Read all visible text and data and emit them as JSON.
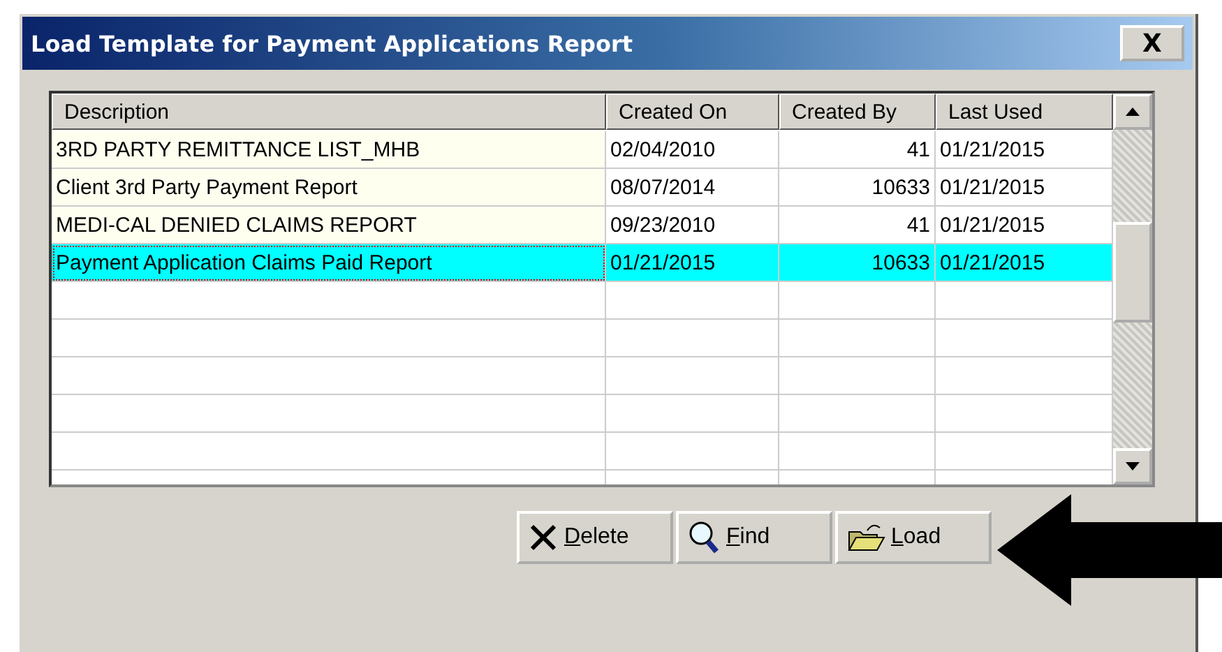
{
  "window": {
    "title": "Load Template for Payment Applications Report",
    "close_label": "X"
  },
  "table": {
    "columns": [
      "Description",
      "Created On",
      "Created By",
      "Last Used"
    ],
    "rows": [
      {
        "cells": [
          "3RD PARTY REMITTANCE LIST_MHB",
          "02/04/2010",
          "41",
          "01/21/2015"
        ],
        "selected": false
      },
      {
        "cells": [
          "Client 3rd Party Payment Report",
          "08/07/2014",
          "10633",
          "01/21/2015"
        ],
        "selected": false
      },
      {
        "cells": [
          "MEDI-CAL DENIED CLAIMS REPORT",
          "09/23/2010",
          "41",
          "01/21/2015"
        ],
        "selected": false
      },
      {
        "cells": [
          "Payment Application Claims Paid Report",
          "01/21/2015",
          "10633",
          "01/21/2015"
        ],
        "selected": true
      }
    ]
  },
  "buttons": [
    {
      "label": "Delete",
      "kind": "delete"
    },
    {
      "label": "Find",
      "kind": "find"
    },
    {
      "label": "Load",
      "kind": "load"
    }
  ]
}
